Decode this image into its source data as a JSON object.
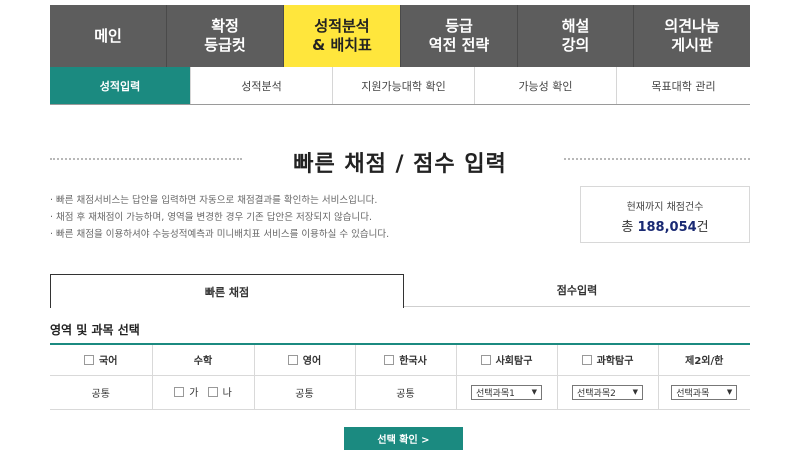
{
  "topnav": {
    "items": [
      {
        "line1": "메인",
        "line2": ""
      },
      {
        "line1": "확정",
        "line2": "등급컷"
      },
      {
        "line1": "성적분석",
        "line2": "& 배치표"
      },
      {
        "line1": "등급",
        "line2": "역전 전략"
      },
      {
        "line1": "해설",
        "line2": "강의"
      },
      {
        "line1": "의견나눔",
        "line2": "게시판"
      }
    ],
    "active_color": "#ffe63c"
  },
  "subnav": {
    "items": [
      {
        "label": "성적입력"
      },
      {
        "label": "성적분석"
      },
      {
        "label": "지원가능대학 확인"
      },
      {
        "label": "가능성 확인"
      },
      {
        "label": "목표대학 관리"
      }
    ],
    "active_color": "#1b8a80"
  },
  "page_title": "빠른 채점 / 점수 입력",
  "info_lines": [
    "· 빠른 채점서비스는 답안을 입력하면 자동으로 채점결과를 확인하는 서비스입니다.",
    "· 채점 후 재채점이 가능하며, 영역을 변경한 경우 기존 답안은 저장되지 않습니다.",
    "· 빠른 채점을 이용하셔야 수능성적예측과 미니배치표 서비스를 이용하실 수 있습니다."
  ],
  "count": {
    "label": "현재까지 채점건수",
    "prefix": "총 ",
    "value": "188,054",
    "suffix": "건"
  },
  "tabs": [
    {
      "label": "빠른 채점"
    },
    {
      "label": "점수입력"
    }
  ],
  "section_title": "영역 및 과목 선택",
  "subjects": {
    "headers": [
      "국어",
      "수학",
      "영어",
      "한국사",
      "사회탐구",
      "과학탐구",
      "제2외/한"
    ],
    "row": {
      "korean": "공통",
      "math_a": "가",
      "math_b": "나",
      "english": "공통",
      "history": "공통",
      "social_select": "선택과목1",
      "science_select": "선택과목2",
      "foreign_select": "선택과목"
    }
  },
  "confirm_button": "선택 확인 >"
}
